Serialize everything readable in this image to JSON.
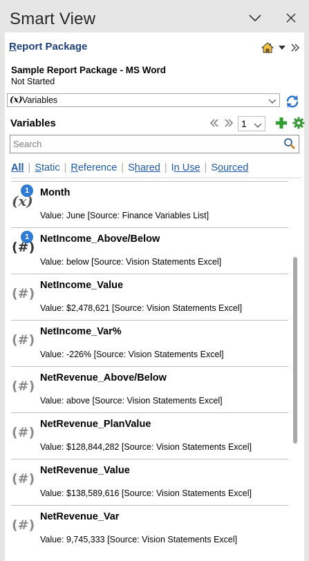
{
  "app": {
    "title": "Smart View"
  },
  "package": {
    "link_first": "R",
    "link_rest": "eport Package",
    "name": "Sample Report Package - MS Word",
    "status": "Not Started"
  },
  "selector": {
    "icon_text": "(x)",
    "value": "Variables"
  },
  "section": {
    "title": "Variables",
    "page": "1"
  },
  "search": {
    "placeholder": "Search"
  },
  "filters": [
    {
      "first": "A",
      "rest": "ll"
    },
    {
      "first": "S",
      "rest": "tatic"
    },
    {
      "first": "R",
      "rest": "eference"
    },
    {
      "first": "S",
      "rest": "hared"
    },
    {
      "first": "I",
      "rest": "n Use"
    },
    {
      "first": "S",
      "rest": "ourced"
    }
  ],
  "variables": [
    {
      "name": "Month",
      "value": "Value: June [Source: Finance Variables List]",
      "icon": "text-variable-icon",
      "badge": "1"
    },
    {
      "name": "NetIncome_Above/Below",
      "value": "Value: below [Source: Vision Statements Excel]",
      "icon": "numeric-variable-icon",
      "badge": "1"
    },
    {
      "name": "NetIncome_Value",
      "value": "Value:  $2,478,621  [Source: Vision Statements Excel]",
      "icon": "numeric-variable-icon"
    },
    {
      "name": "NetIncome_Var%",
      "value": "Value: -226% [Source: Vision Statements Excel]",
      "icon": "numeric-variable-icon"
    },
    {
      "name": "NetRevenue_Above/Below",
      "value": "Value: above [Source: Vision Statements Excel]",
      "icon": "numeric-variable-icon"
    },
    {
      "name": "NetRevenue_PlanValue",
      "value": "Value:  $128,844,282  [Source: Vision Statements Excel]",
      "icon": "numeric-variable-icon"
    },
    {
      "name": "NetRevenue_Value",
      "value": "Value:  $138,589,616  [Source: Vision Statements Excel]",
      "icon": "numeric-variable-icon"
    },
    {
      "name": "NetRevenue_Var",
      "value": "Value:  9,745,333  [Source: Vision Statements Excel]",
      "icon": "numeric-variable-icon"
    }
  ],
  "colors": {
    "accent": "#1f5aa6",
    "badge": "#2e7bd2",
    "add_green": "#2e9e2e"
  }
}
